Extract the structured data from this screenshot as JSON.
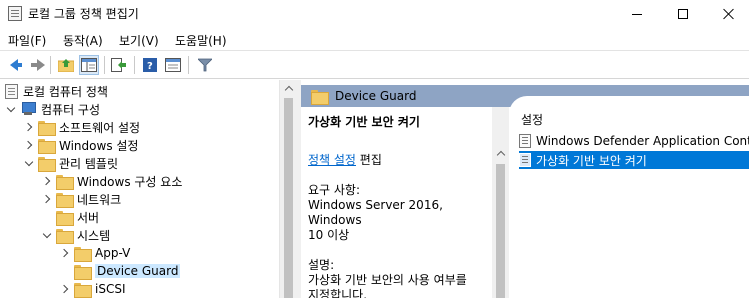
{
  "window": {
    "title": "로컬 그룹 정책 편집기"
  },
  "menu": [
    "파일(F)",
    "동작(A)",
    "보기(V)",
    "도움말(H)"
  ],
  "toolbar": {
    "buttons": [
      "back-icon",
      "forward-icon",
      "up-folder-icon",
      "show-hide-tree-icon",
      "export-list-icon",
      "help-icon",
      "properties-icon",
      "filter-icon"
    ]
  },
  "tree": {
    "items": [
      {
        "label": "로컬 컴퓨터 정책",
        "icon": "policy-doc-icon"
      },
      {
        "label": "컴퓨터 구성",
        "icon": "computer-icon"
      },
      {
        "label": "소프트웨어 설정",
        "icon": "folder-icon"
      },
      {
        "label": "Windows 설정",
        "icon": "folder-icon"
      },
      {
        "label": "관리 템플릿",
        "icon": "folder-icon"
      },
      {
        "label": "Windows 구성 요소",
        "icon": "folder-icon"
      },
      {
        "label": "네트워크",
        "icon": "folder-icon"
      },
      {
        "label": "서버",
        "icon": "folder-icon"
      },
      {
        "label": "시스템",
        "icon": "folder-icon"
      },
      {
        "label": "App-V",
        "icon": "folder-icon"
      },
      {
        "label": "Device Guard",
        "icon": "folder-icon",
        "selected": true
      },
      {
        "label": "iSCSI",
        "icon": "folder-icon"
      }
    ]
  },
  "right": {
    "header": "Device Guard",
    "desc_title": "가상화 기반 보안 켜기",
    "edit_link": "정책 설정",
    "edit_suffix": " 편집",
    "req_label": "요구 사항:",
    "req_line1": "Windows Server 2016, Windows",
    "req_line2": "10 이상",
    "desc_label": "설명:",
    "desc_line1": "가상화 기반 보안의 사용 여부를",
    "desc_line2": "지정합니다."
  },
  "list": {
    "header": "설정",
    "items": [
      {
        "label": "Windows Defender Application Control"
      },
      {
        "label": "가상화 기반 보안 켜기",
        "selected": true
      }
    ]
  },
  "colors": {
    "selection": "#0078d7",
    "tree_selection": "#cce8ff",
    "header_band": "#8ea4c4",
    "link": "#0066cc"
  }
}
